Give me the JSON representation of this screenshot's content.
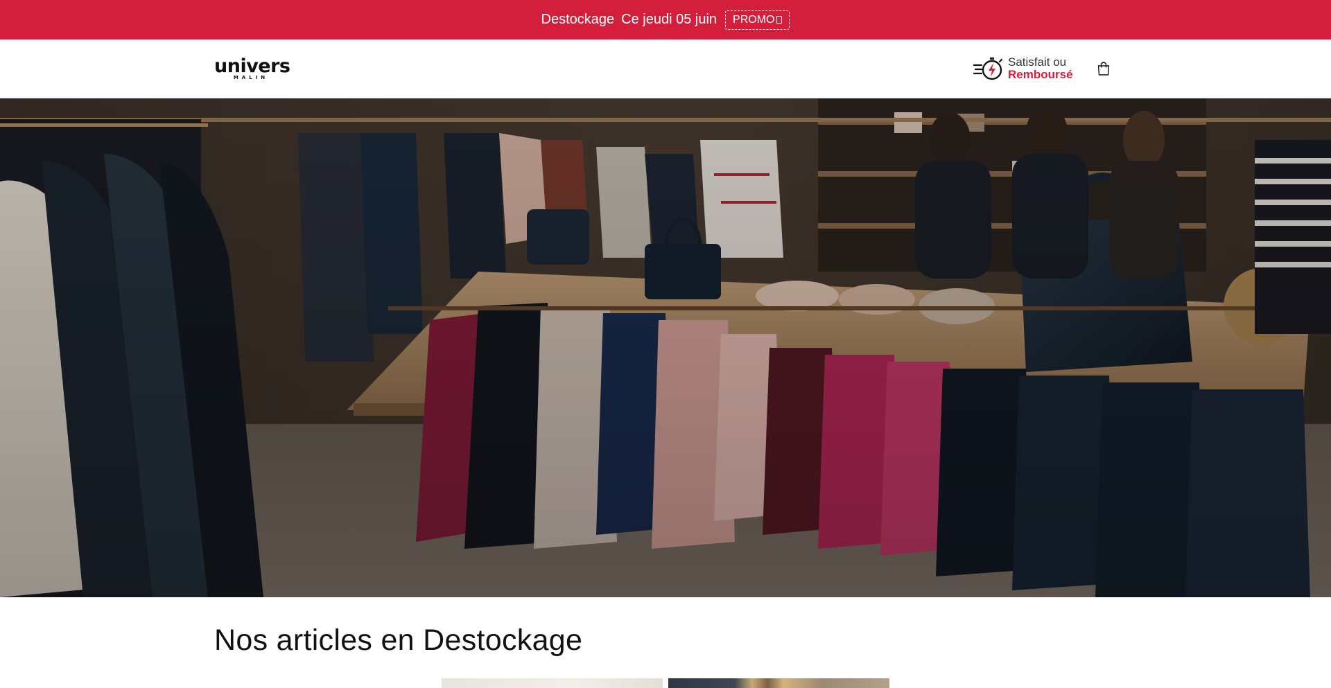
{
  "announcement": {
    "label": "Destockage",
    "date": "Ce jeudi 05 juin",
    "promo": "PROMO"
  },
  "header": {
    "logo_main": "univers",
    "logo_sub": "MALIN",
    "guarantee_line1": "Satisfait ou",
    "guarantee_line2": "Remboursé",
    "icons": {
      "guarantee": "fast-stopwatch-icon",
      "cart": "shopping-bag-icon"
    }
  },
  "hero": {
    "scene": "clothing-boutique-photo"
  },
  "section": {
    "title": "Nos articles en Destockage"
  },
  "colors": {
    "brand_red": "#d31f3c",
    "text": "#121212",
    "background": "#ffffff"
  }
}
